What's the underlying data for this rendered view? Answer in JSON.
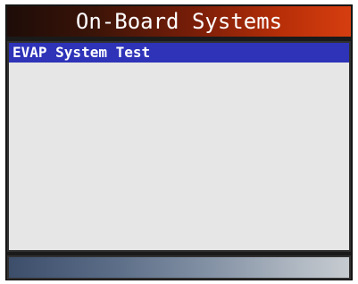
{
  "header": {
    "title": "On-Board Systems"
  },
  "menu": {
    "items": [
      {
        "label": "EVAP System Test",
        "selected": true
      }
    ]
  },
  "colors": {
    "title_gradient_start": "#1e0c08",
    "title_gradient_end": "#d63e10",
    "selection_highlight": "#2e33b8",
    "list_background": "#e6e6e6",
    "status_gradient_start": "#3c4e6a",
    "status_gradient_end": "#c6cbd0"
  }
}
